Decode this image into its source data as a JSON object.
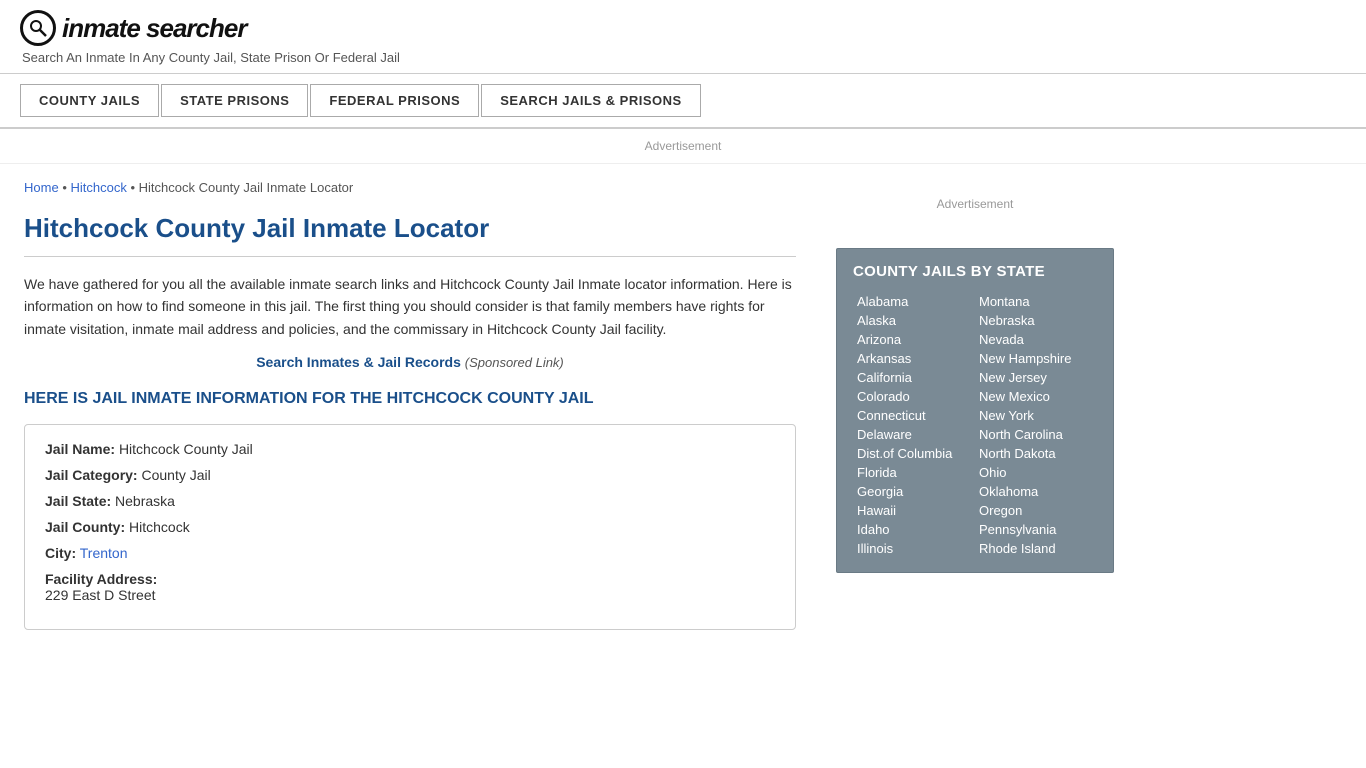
{
  "header": {
    "logo_icon": "🔍",
    "logo_text": "inmate searcher",
    "tagline": "Search An Inmate In Any County Jail, State Prison Or Federal Jail"
  },
  "nav": {
    "items": [
      {
        "label": "COUNTY JAILS"
      },
      {
        "label": "STATE PRISONS"
      },
      {
        "label": "FEDERAL PRISONS"
      },
      {
        "label": "SEARCH JAILS & PRISONS"
      }
    ]
  },
  "ad_banner": "Advertisement",
  "breadcrumb": {
    "home": "Home",
    "separator": " • ",
    "link2": "Hitchcock",
    "separator2": " • ",
    "current": "Hitchcock County Jail Inmate Locator"
  },
  "page_title": "Hitchcock County Jail Inmate Locator",
  "description": "We have gathered for you all the available inmate search links and Hitchcock County Jail Inmate locator information. Here is information on how to find someone in this jail. The first thing you should consider is that family members have rights for inmate visitation, inmate mail address and policies, and the commissary in Hitchcock County Jail facility.",
  "search_link": {
    "text": "Search Inmates & Jail Records",
    "sponsored": "(Sponsored Link)"
  },
  "section_heading": "HERE IS JAIL INMATE INFORMATION FOR THE HITCHCOCK COUNTY JAIL",
  "info_box": {
    "rows": [
      {
        "label": "Jail Name:",
        "value": "Hitchcock County Jail",
        "class": ""
      },
      {
        "label": "Jail Category:",
        "value": "County Jail",
        "class": ""
      },
      {
        "label": "Jail State:",
        "value": "Nebraska",
        "class": ""
      },
      {
        "label": "Jail County:",
        "value": "Hitchcock",
        "class": ""
      },
      {
        "label": "City:",
        "value": "Trenton",
        "class": "city"
      },
      {
        "label": "Facility Address:",
        "value": "229 East D Street",
        "class": ""
      }
    ]
  },
  "sidebar": {
    "ad_text": "Advertisement",
    "widget_title": "COUNTY JAILS BY STATE",
    "states_col1": [
      "Alabama",
      "Alaska",
      "Arizona",
      "Arkansas",
      "California",
      "Colorado",
      "Connecticut",
      "Delaware",
      "Dist.of Columbia",
      "Florida",
      "Georgia",
      "Hawaii",
      "Idaho",
      "Illinois"
    ],
    "states_col2": [
      "Montana",
      "Nebraska",
      "Nevada",
      "New Hampshire",
      "New Jersey",
      "New Mexico",
      "New York",
      "North Carolina",
      "North Dakota",
      "Ohio",
      "Oklahoma",
      "Oregon",
      "Pennsylvania",
      "Rhode Island"
    ]
  }
}
